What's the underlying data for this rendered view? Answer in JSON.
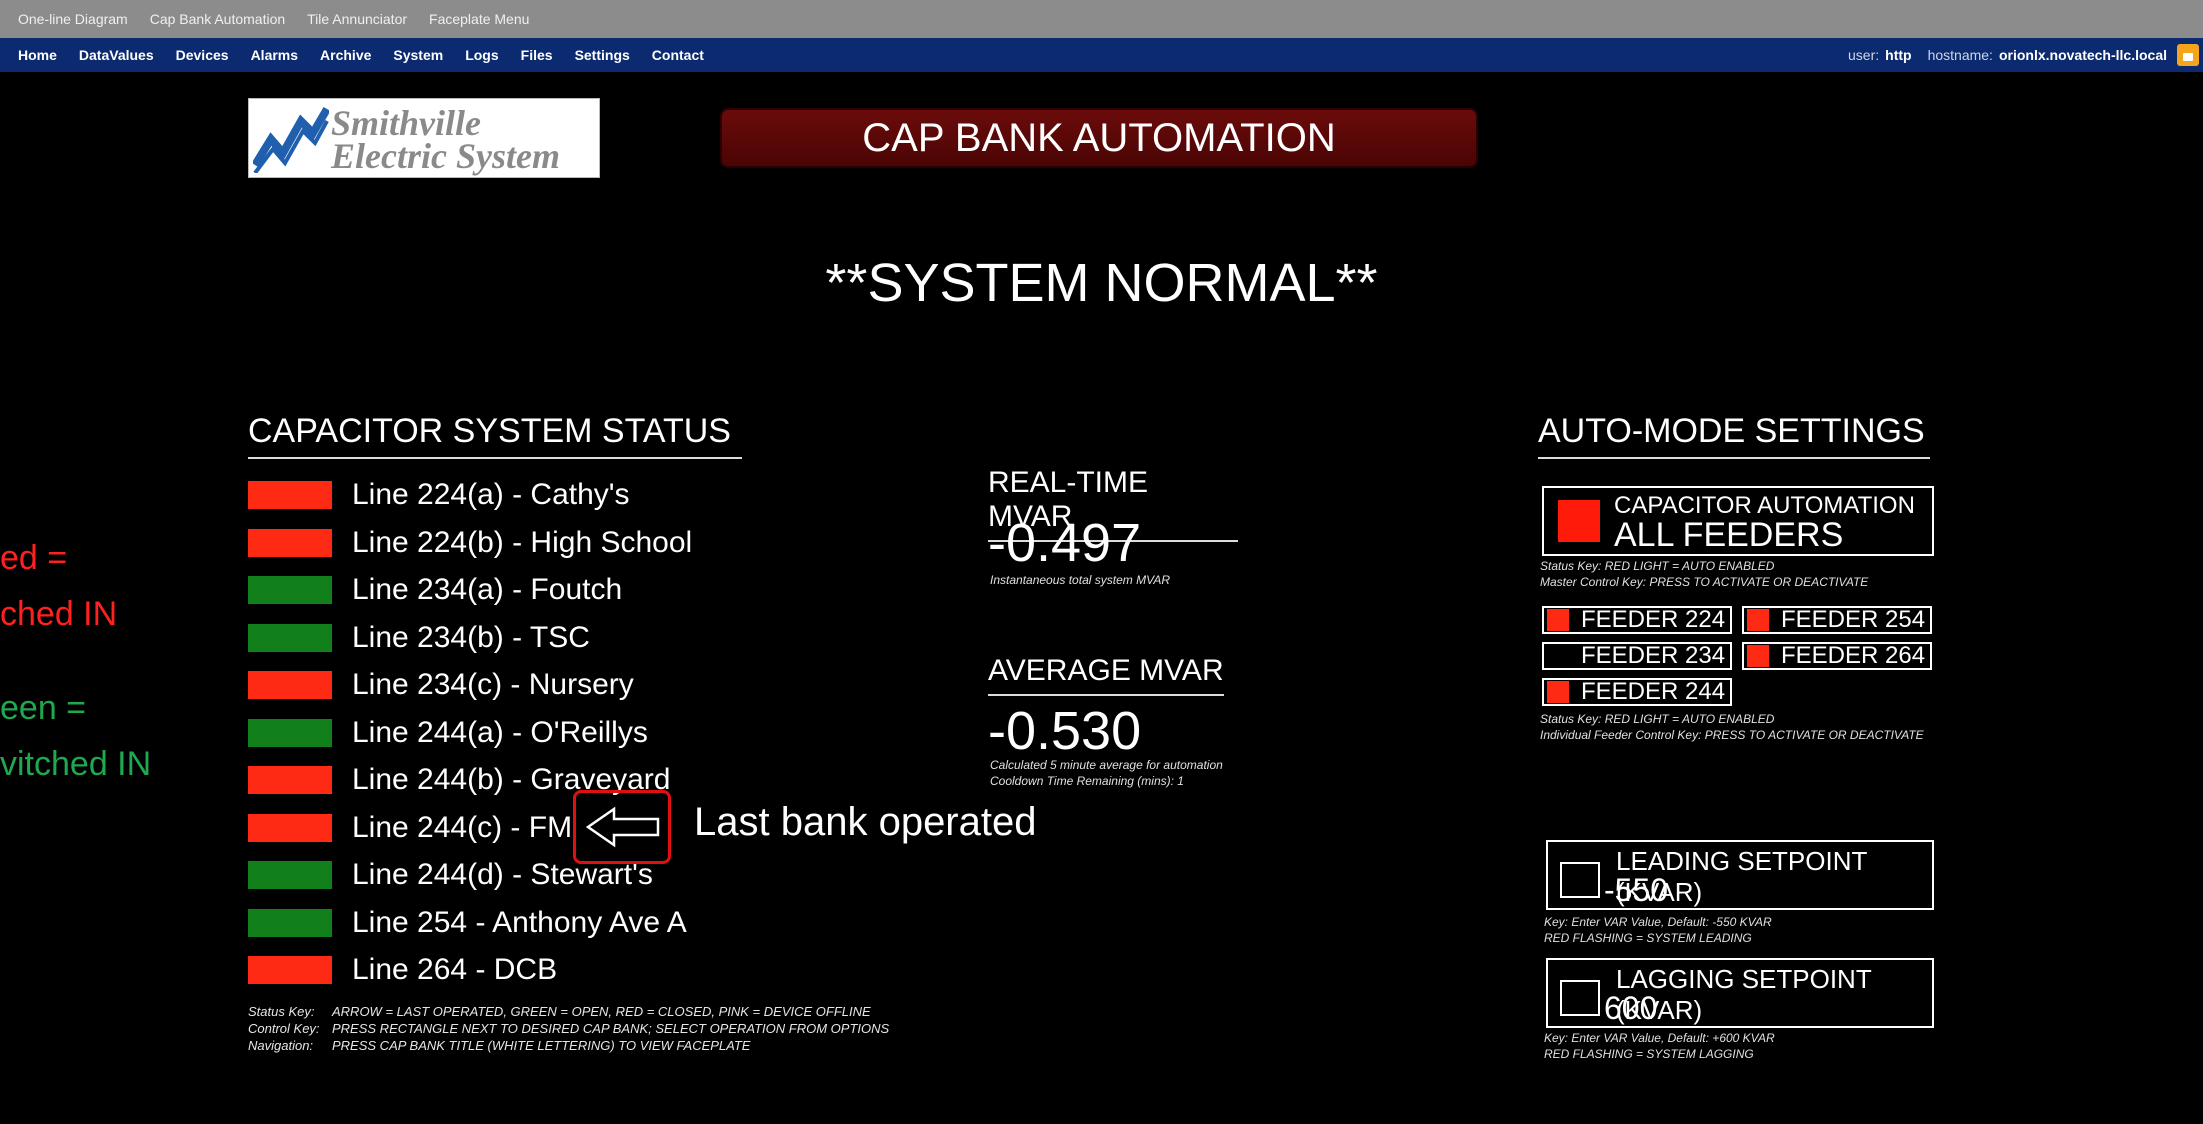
{
  "nav_top": [
    "One-line Diagram",
    "Cap Bank Automation",
    "Tile Annunciator",
    "Faceplate Menu"
  ],
  "nav_main": [
    "Home",
    "DataValues",
    "Devices",
    "Alarms",
    "Archive",
    "System",
    "Logs",
    "Files",
    "Settings",
    "Contact"
  ],
  "user": {
    "user_label": "user:",
    "user_value": "http",
    "host_label": "hostname:",
    "host_value": "orionlx.novatech-llc.local"
  },
  "logo": {
    "line1": "Smithville",
    "line2": "Electric System"
  },
  "page_title": "CAP BANK AUTOMATION",
  "system_status": "**SYSTEM NORMAL**",
  "left_notes": {
    "red_1": "ed =",
    "red_2": "ched IN",
    "green_1": "een =",
    "green_2": "vitched IN"
  },
  "colors": {
    "red": "#ff2a14",
    "green": "#117f1a",
    "title_bg": "#5a0606",
    "nav_bg": "#0b2a6f"
  },
  "capacitor_status": {
    "title": "CAPACITOR SYSTEM STATUS",
    "banks": [
      {
        "label": "Line 224(a) - Cathy's",
        "state": "red"
      },
      {
        "label": "Line 224(b) - High School",
        "state": "red"
      },
      {
        "label": "Line 234(a) - Foutch",
        "state": "green"
      },
      {
        "label": "Line 234(b) - TSC",
        "state": "green"
      },
      {
        "label": "Line 234(c) - Nursery",
        "state": "red"
      },
      {
        "label": "Line 244(a) - O'Reillys",
        "state": "green"
      },
      {
        "label": "Line 244(b) - Graveyard",
        "state": "red"
      },
      {
        "label": "Line 244(c) - FM",
        "state": "red"
      },
      {
        "label": "Line 244(d) - Stewart's",
        "state": "green"
      },
      {
        "label": "Line 254 - Anthony Ave A",
        "state": "green"
      },
      {
        "label": "Line 264 - DCB",
        "state": "red"
      }
    ],
    "keys": [
      {
        "k": "Status Key:",
        "v": "ARROW = LAST OPERATED,  GREEN = OPEN, RED = CLOSED, PINK = DEVICE OFFLINE"
      },
      {
        "k": "Control Key:",
        "v": "PRESS RECTANGLE NEXT TO DESIRED CAP BANK; SELECT OPERATION FROM OPTIONS"
      },
      {
        "k": "Navigation:",
        "v": "PRESS CAP BANK TITLE (WHITE LETTERING) TO VIEW FACEPLATE"
      }
    ]
  },
  "annotation": "Last bank operated",
  "realtime": {
    "title": "REAL-TIME MVAR",
    "value": "-0.497",
    "note": "Instantaneous total system MVAR"
  },
  "average": {
    "title": "AVERAGE MVAR",
    "value": "-0.530",
    "note1": "Calculated 5 minute average for automation",
    "note2": "Cooldown Time Remaining (mins):  1"
  },
  "auto_mode": {
    "title": "AUTO-MODE SETTINGS",
    "master_line1": "CAPACITOR AUTOMATION",
    "master_line2": "ALL FEEDERS",
    "master_key1": "Status Key: RED LIGHT = AUTO ENABLED",
    "master_key2": "Master Control Key: PRESS TO ACTIVATE OR DEACTIVATE",
    "feeders": [
      {
        "label": "FEEDER 224",
        "enabled": true
      },
      {
        "label": "FEEDER 254",
        "enabled": true
      },
      {
        "label": "FEEDER 234",
        "enabled": false
      },
      {
        "label": "FEEDER 264",
        "enabled": true
      },
      {
        "label": "FEEDER 244",
        "enabled": true
      }
    ],
    "feeder_key1": "Status Key: RED LIGHT = AUTO ENABLED",
    "feeder_key2": "Individual Feeder Control Key: PRESS TO ACTIVATE OR DEACTIVATE",
    "leading": {
      "title": "LEADING SETPOINT (KVAR)",
      "value": "-550",
      "key1": "Key:  Enter VAR Value, Default: -550 KVAR",
      "key2": "RED FLASHING = SYSTEM LEADING"
    },
    "lagging": {
      "title": "LAGGING SETPOINT (KVAR)",
      "value": "600",
      "key1": "Key:  Enter VAR Value, Default: +600 KVAR",
      "key2": "RED FLASHING = SYSTEM LAGGING"
    }
  }
}
